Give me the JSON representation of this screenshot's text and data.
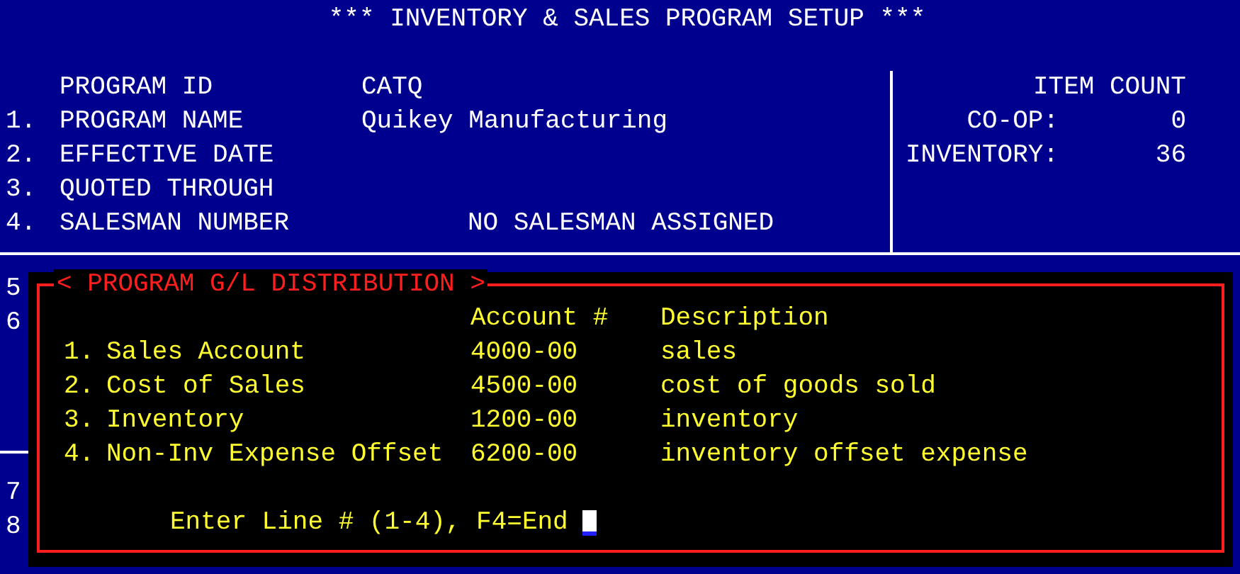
{
  "title": "*** INVENTORY & SALES PROGRAM SETUP ***",
  "program_fields": [
    {
      "label": "PROGRAM ID",
      "value": "CATQ"
    },
    {
      "number": "1.",
      "label": "PROGRAM NAME",
      "value": "Quikey Manufacturing"
    },
    {
      "number": "2.",
      "label": "EFFECTIVE DATE"
    },
    {
      "number": "3.",
      "label": "QUOTED THROUGH"
    },
    {
      "number": "4.",
      "label": "SALESMAN NUMBER",
      "note": "NO SALESMAN ASSIGNED"
    }
  ],
  "item_count": {
    "heading": "ITEM COUNT",
    "counts": [
      {
        "label": "CO-OP:",
        "value": "0"
      },
      {
        "label": "INVENTORY:",
        "value": "36"
      }
    ]
  },
  "line_numbers": [
    "5",
    "6",
    "7",
    "8"
  ],
  "gl_distribution": {
    "title": "< PROGRAM G/L DISTRIBUTION >",
    "columns": [
      "Account #",
      "Description"
    ],
    "rows": [
      {
        "number": "1.",
        "name": "Sales Account",
        "account": "4000-00",
        "description": "sales"
      },
      {
        "number": "2.",
        "name": "Cost of Sales",
        "account": "4500-00",
        "description": "cost of goods sold"
      },
      {
        "number": "3.",
        "name": "Inventory",
        "account": "1200-00",
        "description": "inventory"
      },
      {
        "number": "4.",
        "name": "Non-Inv Expense Offset",
        "account": "6200-00",
        "description": "inventory offset expense"
      }
    ],
    "prompt": "Enter Line # (1-4), F4=End"
  }
}
